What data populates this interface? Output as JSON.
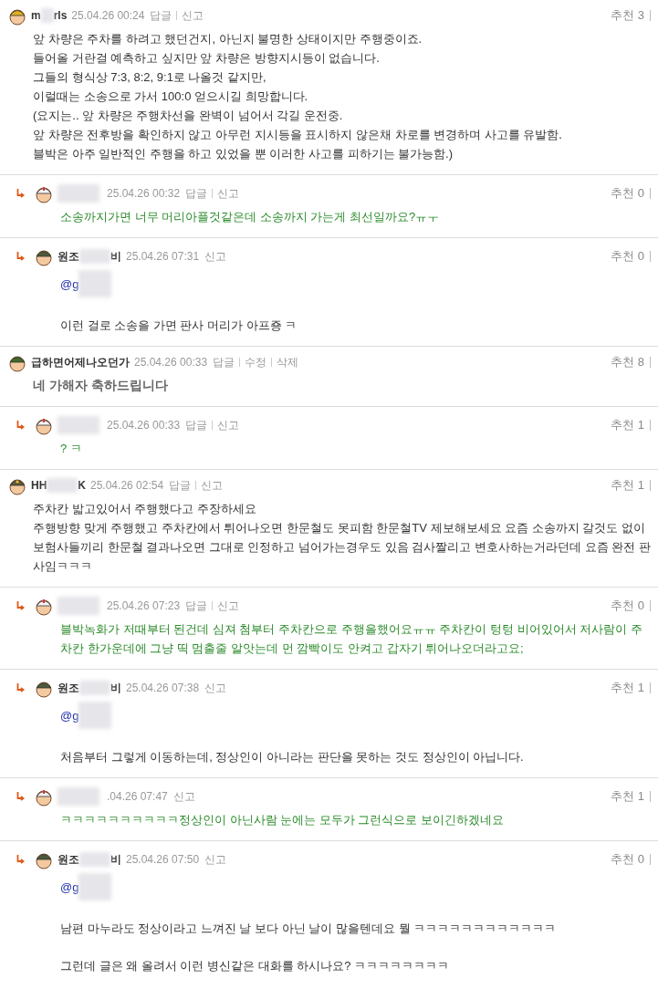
{
  "comments": [
    {
      "author_parts": [
        "m",
        "rls"
      ],
      "avatar": {
        "kind": "helmet"
      },
      "date": "25.04.26 00:24",
      "actions": [
        "답글",
        "신고"
      ],
      "recommend_label": "추천",
      "recommend_count": "3",
      "kind": "normal",
      "lines": [
        "앞 차량은 주차를 하려고 했던건지, 아닌지 불명한 상태이지만 주행중이죠.",
        "들어올 거란걸 예측하고 싶지만 앞 차량은 방향지시등이 없습니다.",
        "그들의 형식상 7:3, 8:2, 9:1로 나올것 같지만,",
        "이럴때는 소송으로 가서 100:0 얻으시길 희망합니다.",
        "(요지는.. 앞 차량은 주행차선을 완벽이 넘어서 각길 운전중.",
        "앞 차량은 전후방을 확인하지 않고 아무런 지시등을 표시하지 않은채  차로를 변경하며 사고를 유발함.",
        "블박은 아주 일반적인 주행을 하고 있었을 뿐 이러한 사고를 피하기는 불가능함.)"
      ],
      "children": [
        {
          "avatar": {
            "kind": "nurse"
          },
          "date": "25.04.26 00:32",
          "actions": [
            "답글",
            "신고"
          ],
          "recommend_label": "추천",
          "recommend_count": "0",
          "kind": "author",
          "lines": [
            "소송까지가면 너무 머리아플것같은데  소송까지 가는게 최선일까요?ㅠㅜ"
          ]
        },
        {
          "author_parts": [
            "원조",
            "비"
          ],
          "avatar": {
            "kind": "camo"
          },
          "date": "25.04.26 07:31",
          "actions": [
            "신고"
          ],
          "recommend_label": "추천",
          "recommend_count": "0",
          "kind": "normal",
          "mention": "@g",
          "lines": [
            "이런 걸로 소송을 가면 판사 머리가 아프죵 ㅋ"
          ]
        }
      ]
    },
    {
      "author_parts": [
        "급하면어제나오던가"
      ],
      "avatar": {
        "kind": "officer"
      },
      "date": "25.04.26 00:33",
      "actions": [
        "답글",
        "수정",
        "삭제"
      ],
      "recommend_label": "추천",
      "recommend_count": "8",
      "kind": "bold",
      "lines": [
        "네 가해자 축하드립니다"
      ],
      "children": [
        {
          "avatar": {
            "kind": "nurse"
          },
          "date": "25.04.26 00:33",
          "actions": [
            "답글",
            "신고"
          ],
          "recommend_label": "추천",
          "recommend_count": "1",
          "kind": "author",
          "lines": [
            "? ㅋ"
          ]
        }
      ]
    },
    {
      "author_parts": [
        "HH",
        "K"
      ],
      "avatar": {
        "kind": "star"
      },
      "date": "25.04.26 02:54",
      "actions": [
        "답글",
        "신고"
      ],
      "recommend_label": "추천",
      "recommend_count": "1",
      "kind": "normal",
      "lines": [
        "주차칸 밟고있어서 주행했다고 주장하세요",
        "주행방향 맞게 주행했고 주차칸에서 튀어나오면 한문철도 못피함 한문철TV 제보해보세요 요즘 소송까지 갈것도 없이 보험사들끼리 한문철 결과나오면 그대로 인정하고 넘어가는경우도 있음 검사짤리고 변호사하는거라던데 요즘 완전 판사임ㅋㅋㅋ"
      ],
      "children": [
        {
          "avatar": {
            "kind": "nurse"
          },
          "date": "25.04.26 07:23",
          "actions": [
            "답글",
            "신고"
          ],
          "recommend_label": "추천",
          "recommend_count": "0",
          "kind": "author",
          "lines": [
            "블박녹화가 저때부터 된건데 심져 첨부터 주차칸으로 주행을했어요ㅠㅠ 주차칸이 텅텅 비어있어서 저사람이 주차칸 한가운데에 그냥 띡 멈출줄 알앗는데 먼 깜빡이도 안켜고 갑자기 튀어나오더라고요;"
          ]
        },
        {
          "author_parts": [
            "원조",
            "비"
          ],
          "avatar": {
            "kind": "camo"
          },
          "date": "25.04.26 07:38",
          "actions": [
            "신고"
          ],
          "recommend_label": "추천",
          "recommend_count": "1",
          "kind": "normal",
          "mention": "@g",
          "lines": [
            "처음부터 그렇게 이동하는데, 정상인이 아니라는 판단을 못하는 것도 정상인이 아닙니다."
          ]
        },
        {
          "avatar": {
            "kind": "nurse"
          },
          "date": ".04.26 07:47",
          "actions": [
            "신고"
          ],
          "recommend_label": "추천",
          "recommend_count": "1",
          "kind": "author",
          "lines": [
            "ㅋㅋㅋㅋㅋㅋㅋㅋㅋㅋ정상인이 아닌사람 눈에는 모두가 그런식으로 보이긴하겠네요"
          ]
        },
        {
          "author_parts": [
            "원조",
            "비"
          ],
          "avatar": {
            "kind": "camo"
          },
          "date": "25.04.26 07:50",
          "actions": [
            "신고"
          ],
          "recommend_label": "추천",
          "recommend_count": "0",
          "kind": "normal",
          "mention": "@g",
          "lines": [
            "남편 마누라도 정상이라고 느껴진 날 보다 아닌 날이 많을텐데요 뭘  ㅋㅋㅋㅋㅋㅋㅋㅋㅋㅋㅋㅋ",
            "그런데 글은 왜 올려서 이런 병신같은 대화를 하시나요? ㅋㅋㅋㅋㅋㅋㅋㅋ"
          ]
        }
      ]
    }
  ]
}
